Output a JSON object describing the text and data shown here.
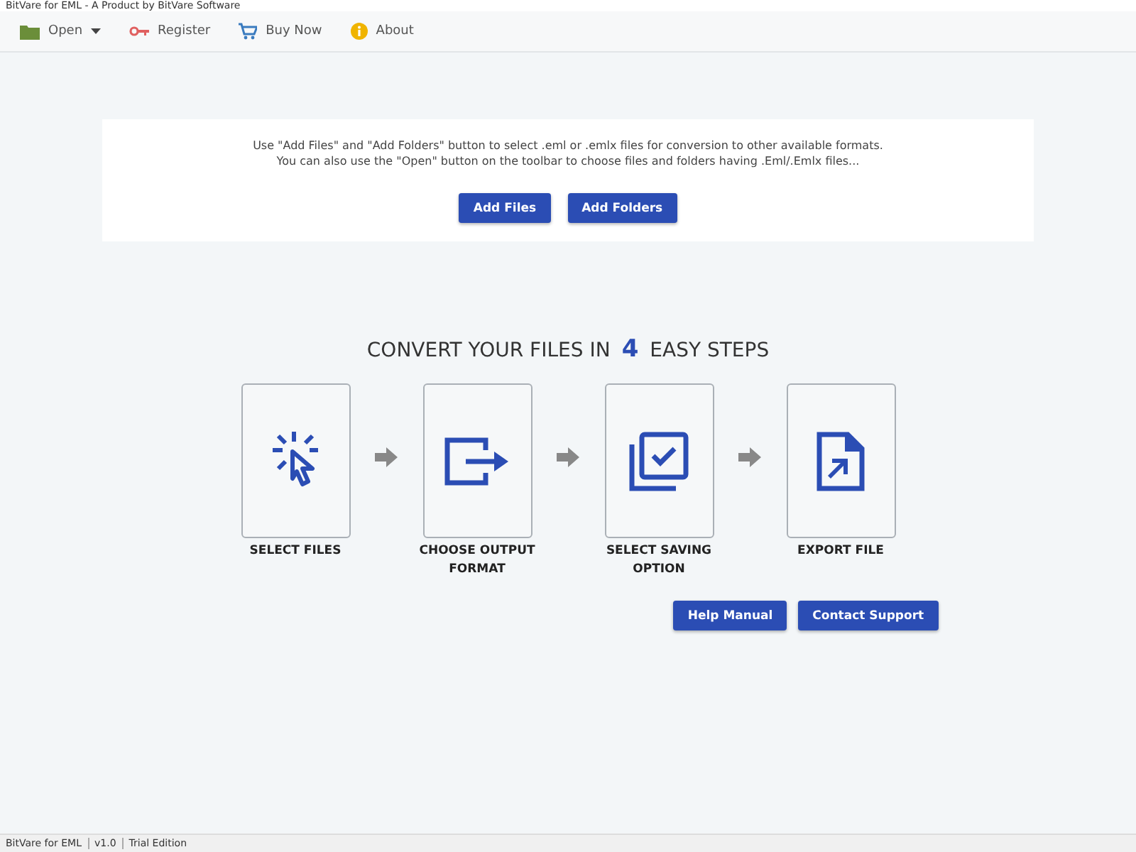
{
  "window": {
    "title": "BitVare for EML - A Product by BitVare Software"
  },
  "toolbar": [
    {
      "kind": "open",
      "label": "Open"
    },
    {
      "kind": "register",
      "label": "Register"
    },
    {
      "kind": "buy",
      "label": "Buy Now"
    },
    {
      "kind": "about",
      "label": "About"
    }
  ],
  "intro": {
    "lines": [
      "Use \"Add Files\" and \"Add Folders\" button to select .eml or .emlx files for conversion to other available formats.",
      "You can also use the \"Open\" button on the toolbar to choose files and folders having .Eml/.Emlx files..."
    ],
    "buttons": [
      "Add Files",
      "Add Folders"
    ]
  },
  "steps_heading": {
    "before": "CONVERT YOUR FILES IN",
    "number": "4",
    "after": "EASY STEPS"
  },
  "steps": [
    {
      "kind": "select",
      "label": "SELECT FILES"
    },
    {
      "kind": "output",
      "label": "CHOOSE OUTPUT FORMAT"
    },
    {
      "kind": "saving",
      "label": "SELECT SAVING OPTION"
    },
    {
      "kind": "export",
      "label": "EXPORT FILE"
    }
  ],
  "help_buttons": [
    "Help Manual",
    "Contact Support"
  ],
  "status_bar": [
    "BitVare for EML",
    "v1.0",
    "Trial Edition"
  ]
}
